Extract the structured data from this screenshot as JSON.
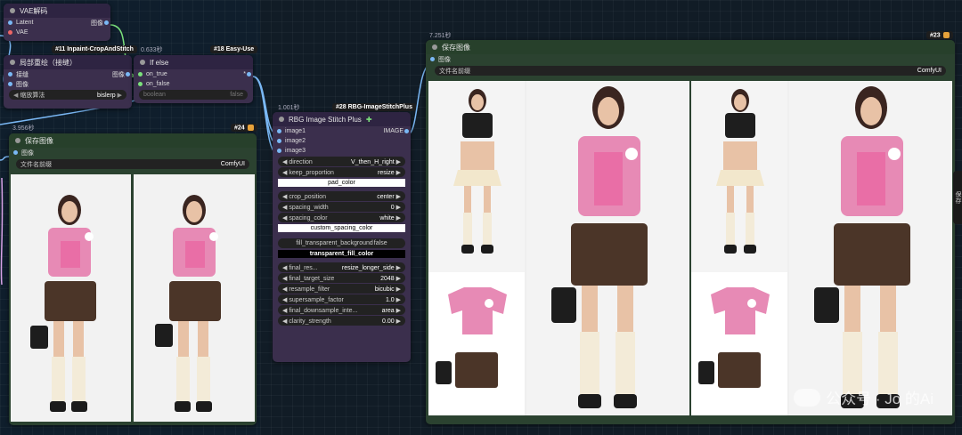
{
  "vae_node": {
    "title": "VAE解码",
    "inputs": [
      "Latent",
      "VAE"
    ],
    "output": "图像"
  },
  "inpaint_node": {
    "tag": "#11 Inpaint-CropAndStitch",
    "title": "局部重绘（接缝）",
    "inputs": [
      "接缝",
      "图像"
    ],
    "output": "图像",
    "widget_label": "缩放算法",
    "widget_value": "bislerp"
  },
  "ifelse_node": {
    "tag": "#18 Easy-Use",
    "time": "0.633秒",
    "title": "If else",
    "inputs": [
      "on_true",
      "on_false"
    ],
    "output": "*",
    "widget_label": "boolean",
    "widget_value": "false"
  },
  "save24_node": {
    "tag": "#24",
    "time": "3.956秒",
    "title": "保存图像",
    "input": "图像",
    "prefix_label": "文件名前缀",
    "prefix_value": "ComfyUI"
  },
  "stitch_node": {
    "tag": "#28 RBG-ImageStitchPlus",
    "time": "1.001秒",
    "title": "RBG Image Stitch Plus",
    "inputs": [
      "image1",
      "image2",
      "image3"
    ],
    "output": "IMAGE",
    "w_direction": {
      "label": "direction",
      "value": "V_then_H_right"
    },
    "w_keep": {
      "label": "keep_proportion",
      "value": "resize"
    },
    "pad_color": "pad_color",
    "w_crop": {
      "label": "crop_position",
      "value": "center"
    },
    "w_spacing_w": {
      "label": "spacing_width",
      "value": "0"
    },
    "w_spacing_c": {
      "label": "spacing_color",
      "value": "white"
    },
    "custom_spacing": "custom_spacing_color",
    "fill_transparent": "fill_transparent_background",
    "fill_transparent_value": "false",
    "transparent_fill": "transparent_fill_color",
    "w_final_res": {
      "label": "final_res...",
      "value": "resize_longer_side"
    },
    "w_target": {
      "label": "final_target_size",
      "value": "2048"
    },
    "w_resample": {
      "label": "resample_filter",
      "value": "bicubic"
    },
    "w_super": {
      "label": "supersample_factor",
      "value": "1.0"
    },
    "w_downsample": {
      "label": "final_downsample_inte...",
      "value": "area"
    },
    "w_clarity": {
      "label": "clarity_strength",
      "value": "0.00"
    }
  },
  "save23_node": {
    "tag": "#23",
    "time": "7.251秒",
    "title": "保存图像",
    "input": "图像",
    "prefix_label": "文件名前缀",
    "prefix_value": "ComfyUI"
  },
  "watermark": {
    "text": "公众号 · Jo   的Ai"
  },
  "side_tab": "保存",
  "colors": {
    "accent_blue": "#7ab8f5",
    "node_green": "#2b4230",
    "node_purple": "#3b2f4d",
    "badge": "#e7a23a"
  }
}
